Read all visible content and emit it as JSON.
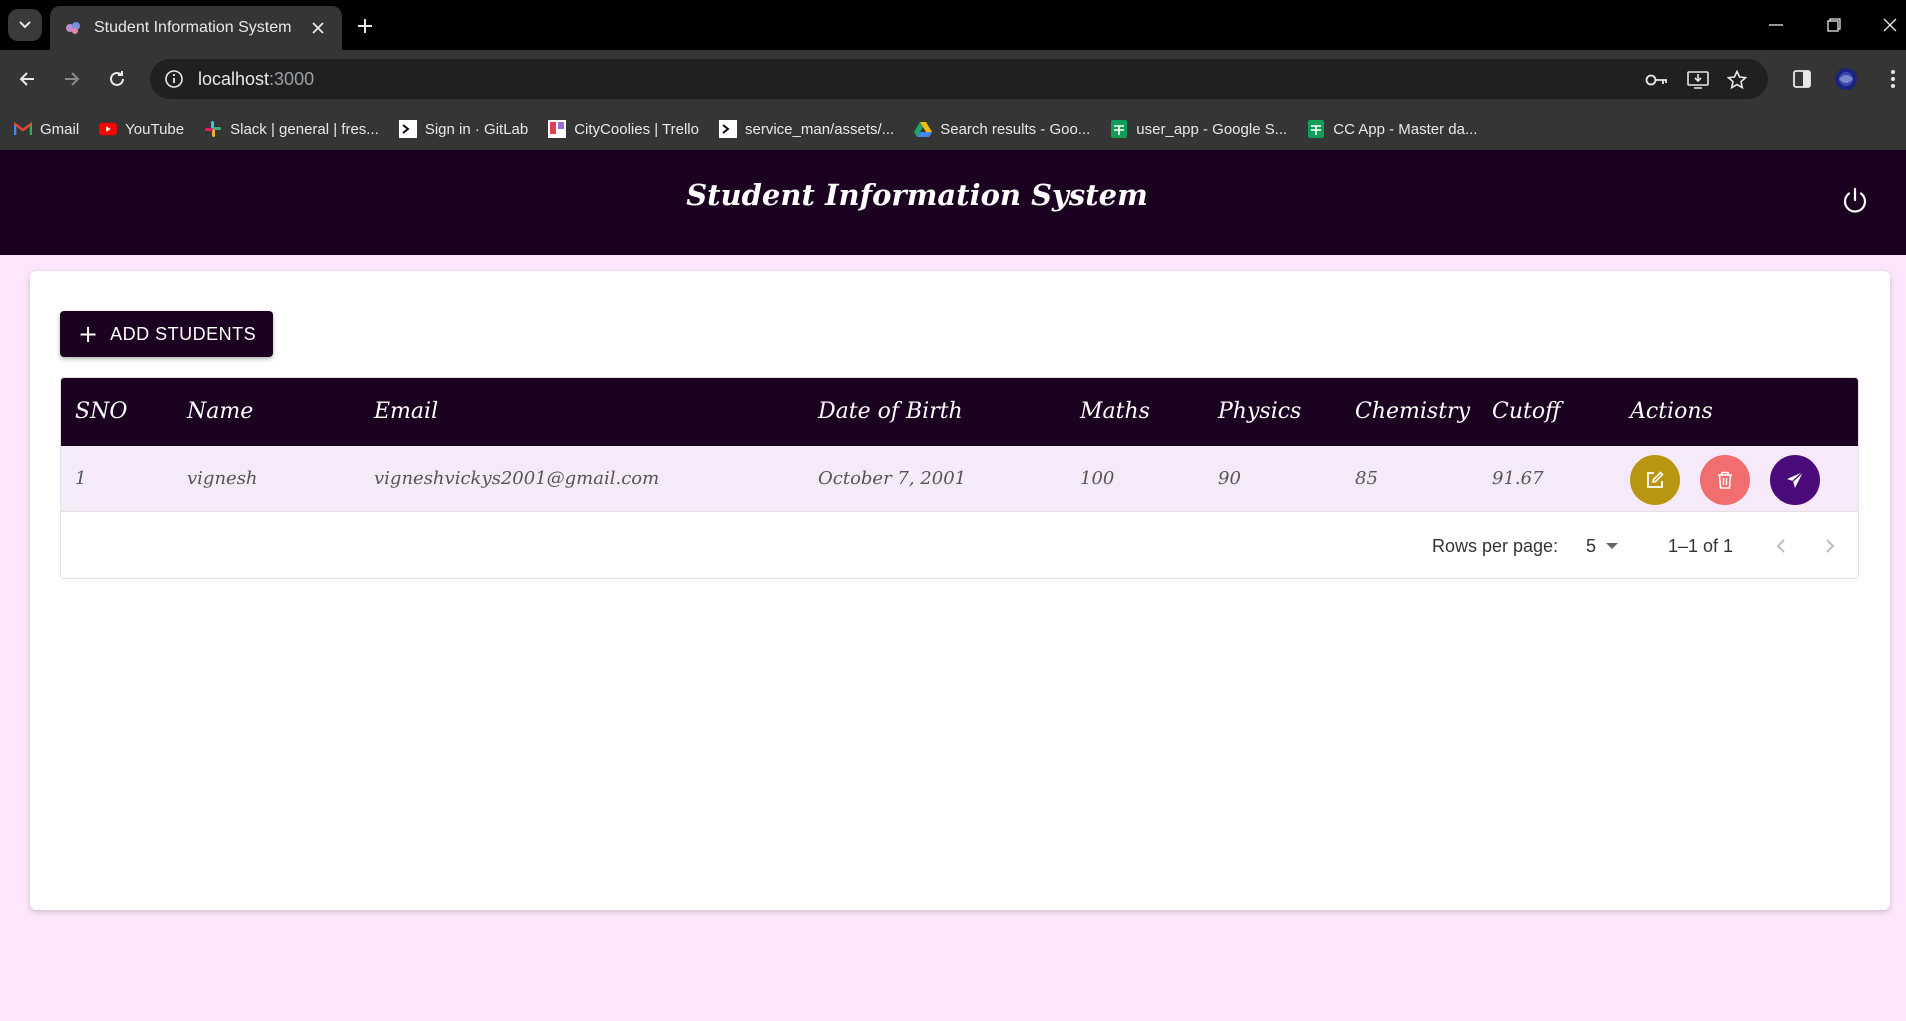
{
  "browser": {
    "tab_title": "Student Information System",
    "url_host": "localhost",
    "url_port": ":3000",
    "bookmarks": [
      {
        "label": "Gmail",
        "icon": "gmail-icon"
      },
      {
        "label": "YouTube",
        "icon": "youtube-icon"
      },
      {
        "label": "Slack | general | fres...",
        "icon": "slack-icon"
      },
      {
        "label": "Sign in · GitLab",
        "icon": "gitlab-icon"
      },
      {
        "label": "CityCoolies | Trello",
        "icon": "trello-icon"
      },
      {
        "label": "service_man/assets/...",
        "icon": "github-icon"
      },
      {
        "label": "Search results - Goo...",
        "icon": "drive-icon"
      },
      {
        "label": "user_app - Google S...",
        "icon": "sheets-icon"
      },
      {
        "label": "CC App - Master da...",
        "icon": "sheets-icon"
      }
    ]
  },
  "app": {
    "title": "Student Information System",
    "add_button_label": "ADD STUDENTS",
    "columns": [
      "SNO",
      "Name",
      "Email",
      "Date of Birth",
      "Maths",
      "Physics",
      "Chemistry",
      "Cutoff",
      "Actions"
    ],
    "rows": [
      {
        "sno": "1",
        "name": "vignesh",
        "email": "vigneshvickys2001@gmail.com",
        "dob": "October 7, 2001",
        "maths": "100",
        "physics": "90",
        "chemistry": "85",
        "cutoff": "91.67"
      }
    ],
    "actions": {
      "edit_color": "#b8960f",
      "delete_color": "#f26d6d",
      "send_color": "#4a0a7a"
    },
    "pagination": {
      "rows_per_page_label": "Rows per page:",
      "rows_per_page_value": "5",
      "range_text": "1–1 of 1"
    }
  },
  "colors": {
    "header_bg": "#1c0221",
    "page_bg": "#fde6fb",
    "row_bg": "#f6eafa"
  }
}
